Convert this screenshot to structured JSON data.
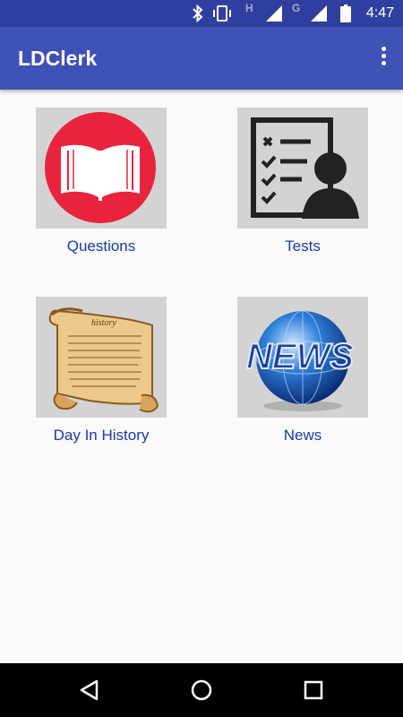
{
  "status_bar": {
    "time": "4:47",
    "network_h": "H",
    "network_g": "G",
    "icons": [
      "bluetooth-icon",
      "vibrate-icon",
      "signal-icon",
      "signal-icon",
      "battery-icon"
    ]
  },
  "app_bar": {
    "title": "LDClerk",
    "menu_icon": "overflow-menu-icon"
  },
  "tiles": [
    {
      "label": "Questions",
      "icon": "open-book-icon"
    },
    {
      "label": "Tests",
      "icon": "checklist-person-icon"
    },
    {
      "label": "Day In History",
      "icon": "scroll-icon"
    },
    {
      "label": "News",
      "icon": "news-globe-icon"
    }
  ],
  "scroll_text": "history",
  "news_text": "NEWS",
  "nav_bar": {
    "icons": [
      "back-icon",
      "home-icon",
      "recents-icon"
    ]
  },
  "colors": {
    "status_bar": "#303f9f",
    "app_bar": "#3f51b5",
    "label": "#1a3aa8",
    "book_circle": "#e8243c"
  }
}
